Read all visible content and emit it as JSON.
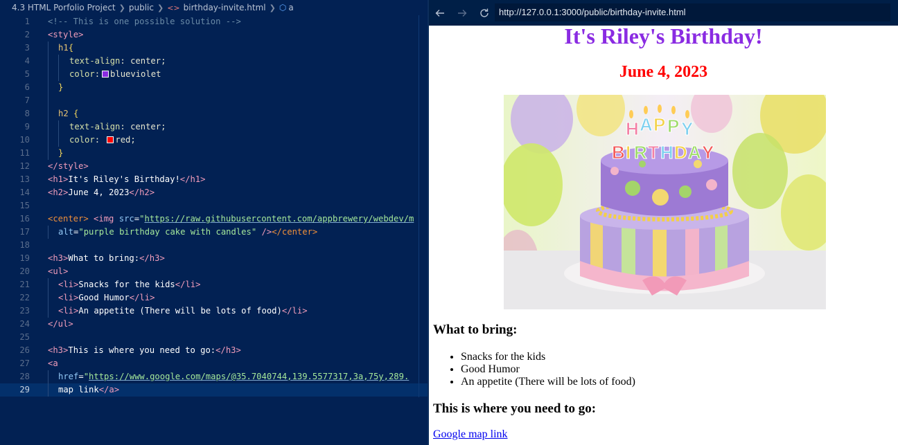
{
  "editor": {
    "breadcrumb": {
      "folder": "4.3 HTML Porfolio Project",
      "subfolder": "public",
      "file": "birthday-invite.html",
      "symbol": "a"
    },
    "lines": [
      "1",
      "2",
      "3",
      "4",
      "5",
      "6",
      "7",
      "8",
      "9",
      "10",
      "11",
      "12",
      "13",
      "14",
      "15",
      "16",
      "17",
      "18",
      "19",
      "20",
      "21",
      "22",
      "23",
      "24",
      "25",
      "26",
      "27",
      "28",
      "29"
    ],
    "code": {
      "l1_comment": "<!-- This is one possible solution -->",
      "style_open": "style",
      "h1_sel": "h1",
      "text_align_prop": "text-align",
      "center_val": "center",
      "color_prop": "color",
      "blueviolet_val": "blueviolet",
      "h2_sel": "h2",
      "red_val": "red",
      "h1_text": "It's Riley's Birthday!",
      "h2_text": "June 4, 2023",
      "img_src_value": "https://raw.githubusercontent.com/appbrewery/webdev/m",
      "img_alt_value": "purple birthday cake with candles",
      "h3_bring": "What to bring:",
      "li1": "Snacks for the kids",
      "li2": "Good Humor",
      "li3": "An appetite (There will be lots of food)",
      "h3_go": "This is where you need to go:",
      "href_value": "https://www.google.com/maps/@35.7040744,139.5577317,3a,75y,289.",
      "link_text": "map link"
    },
    "swatch_colors": {
      "blueviolet": "#8a2be2",
      "red": "#ff0000"
    }
  },
  "browser": {
    "url": "http://127.0.0.1:3000/public/birthday-invite.html",
    "icons": {
      "back": "arrow-left-icon",
      "forward": "arrow-right-icon",
      "reload": "reload-icon"
    },
    "page": {
      "h1": "It's Riley's Birthday!",
      "h2": "June 4, 2023",
      "image_alt": "purple birthday cake with candles",
      "cake_topper": "HAPPY BIRTHDAY",
      "bring_heading": "What to bring:",
      "bring_items": [
        "Snacks for the kids",
        "Good Humor",
        "An appetite (There will be lots of food)"
      ],
      "go_heading": "This is where you need to go:",
      "map_link": "Google map link"
    },
    "colors": {
      "h1": "#8a2be2",
      "h2": "#ff0000",
      "link": "#0000ee"
    }
  }
}
